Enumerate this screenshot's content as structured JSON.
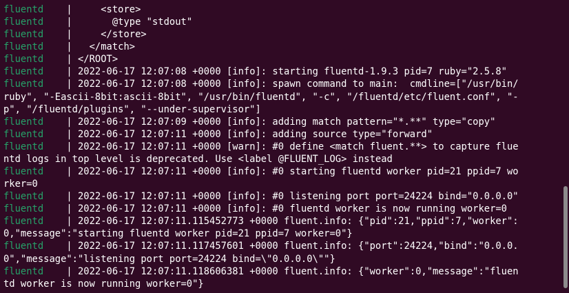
{
  "terminal": {
    "colors": {
      "background": "#300a24",
      "text": "#ffffff",
      "service_prefix": "#26a269",
      "scrollbar": "#8d8a8c"
    },
    "lines": [
      {
        "prefix": "fluentd",
        "sep": "    |     ",
        "text": "<store>"
      },
      {
        "prefix": "fluentd",
        "sep": "    |       ",
        "text": "@type \"stdout\""
      },
      {
        "prefix": "fluentd",
        "sep": "    |     ",
        "text": "</store>"
      },
      {
        "prefix": "fluentd",
        "sep": "    |   ",
        "text": "</match>"
      },
      {
        "prefix": "fluentd",
        "sep": "    | ",
        "text": "</ROOT>"
      },
      {
        "prefix": "fluentd",
        "sep": "    | ",
        "text": "2022-06-17 12:07:08 +0000 [info]: starting fluentd-1.9.3 pid=7 ruby=\"2.5.8\""
      },
      {
        "prefix": "fluentd",
        "sep": "    | ",
        "text": "2022-06-17 12:07:08 +0000 [info]: spawn command to main:  cmdline=[\"/usr/bin/"
      },
      {
        "prefix": "",
        "sep": "",
        "text": "ruby\", \"-Eascii-8bit:ascii-8bit\", \"/usr/bin/fluentd\", \"-c\", \"/fluentd/etc/fluent.conf\", \"-"
      },
      {
        "prefix": "",
        "sep": "",
        "text": "p\", \"/fluentd/plugins\", \"--under-supervisor\"]"
      },
      {
        "prefix": "fluentd",
        "sep": "    | ",
        "text": "2022-06-17 12:07:09 +0000 [info]: adding match pattern=\"*.**\" type=\"copy\""
      },
      {
        "prefix": "fluentd",
        "sep": "    | ",
        "text": "2022-06-17 12:07:11 +0000 [info]: adding source type=\"forward\""
      },
      {
        "prefix": "fluentd",
        "sep": "    | ",
        "text": "2022-06-17 12:07:11 +0000 [warn]: #0 define <match fluent.**> to capture flue"
      },
      {
        "prefix": "",
        "sep": "",
        "text": "ntd logs in top level is deprecated. Use <label @FLUENT_LOG> instead"
      },
      {
        "prefix": "fluentd",
        "sep": "    | ",
        "text": "2022-06-17 12:07:11 +0000 [info]: #0 starting fluentd worker pid=21 ppid=7 wo"
      },
      {
        "prefix": "",
        "sep": "",
        "text": "rker=0"
      },
      {
        "prefix": "fluentd",
        "sep": "    | ",
        "text": "2022-06-17 12:07:11 +0000 [info]: #0 listening port port=24224 bind=\"0.0.0.0\""
      },
      {
        "prefix": "fluentd",
        "sep": "    | ",
        "text": "2022-06-17 12:07:11 +0000 [info]: #0 fluentd worker is now running worker=0"
      },
      {
        "prefix": "fluentd",
        "sep": "    | ",
        "text": "2022-06-17 12:07:11.115452773 +0000 fluent.info: {\"pid\":21,\"ppid\":7,\"worker\":"
      },
      {
        "prefix": "",
        "sep": "",
        "text": "0,\"message\":\"starting fluentd worker pid=21 ppid=7 worker=0\"}"
      },
      {
        "prefix": "fluentd",
        "sep": "    | ",
        "text": "2022-06-17 12:07:11.117457601 +0000 fluent.info: {\"port\":24224,\"bind\":\"0.0.0."
      },
      {
        "prefix": "",
        "sep": "",
        "text": "0\",\"message\":\"listening port port=24224 bind=\\\"0.0.0.0\\\"\"}"
      },
      {
        "prefix": "fluentd",
        "sep": "    | ",
        "text": "2022-06-17 12:07:11.118606381 +0000 fluent.info: {\"worker\":0,\"message\":\"fluen"
      },
      {
        "prefix": "",
        "sep": "",
        "text": "td worker is now running worker=0\"}"
      }
    ]
  }
}
